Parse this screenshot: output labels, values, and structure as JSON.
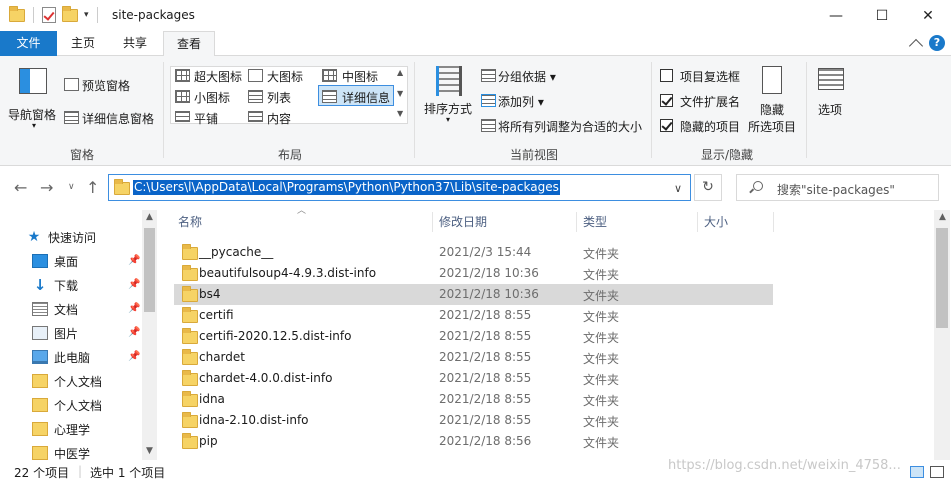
{
  "title": "site-packages",
  "window_controls": {
    "minimize": "—",
    "maximize": "☐",
    "close": "✕"
  },
  "tabs": {
    "file": "文件",
    "home": "主页",
    "share": "共享",
    "view": "查看"
  },
  "ribbon": {
    "pane_group": {
      "nav_pane": "导航窗格",
      "preview_pane": "预览窗格",
      "details_pane": "详细信息窗格",
      "label": "窗格"
    },
    "layout_group": {
      "extra_large_icons": "超大图标",
      "large_icons": "大图标",
      "medium_icons": "中图标",
      "small_icons": "小图标",
      "list": "列表",
      "details": "详细信息",
      "tiles": "平铺",
      "content": "内容",
      "label": "布局"
    },
    "current_view_group": {
      "sort_by": "排序方式",
      "group_by": "分组依据",
      "add_column": "添加列",
      "size_all_columns": "将所有列调整为合适的大小",
      "label": "当前视图"
    },
    "show_hide_group": {
      "item_checkboxes": "项目复选框",
      "item_checkboxes_checked": false,
      "file_extensions": "文件扩展名",
      "file_extensions_checked": true,
      "hidden_items": "隐藏的项目",
      "hidden_items_checked": true,
      "hide_selected_1": "隐藏",
      "hide_selected_2": "所选项目",
      "label": "显示/隐藏"
    },
    "options": "选项"
  },
  "address": {
    "path": "C:\\Users\\l\\AppData\\Local\\Programs\\Python\\Python37\\Lib\\site-packages",
    "search_placeholder": "搜索\"site-packages\""
  },
  "nav": {
    "quick_access": "快速访问",
    "items": [
      {
        "label": "桌面",
        "icon": "desktop-icon",
        "pinned": true
      },
      {
        "label": "下载",
        "icon": "download-icon",
        "pinned": true
      },
      {
        "label": "文档",
        "icon": "document-icon",
        "pinned": true
      },
      {
        "label": "图片",
        "icon": "picture-icon",
        "pinned": true
      },
      {
        "label": "此电脑",
        "icon": "computer-icon",
        "pinned": true
      },
      {
        "label": "个人文档",
        "icon": "folder-icon",
        "pinned": false
      },
      {
        "label": "个人文档",
        "icon": "folder-icon",
        "pinned": false
      },
      {
        "label": "心理学",
        "icon": "folder-icon",
        "pinned": false
      },
      {
        "label": "中医学",
        "icon": "folder-icon",
        "pinned": false
      }
    ]
  },
  "columns": {
    "name": "名称",
    "date": "修改日期",
    "type": "类型",
    "size": "大小"
  },
  "files": [
    {
      "name": "__pycache__",
      "date": "2021/2/3 15:44",
      "type": "文件夹"
    },
    {
      "name": "beautifulsoup4-4.9.3.dist-info",
      "date": "2021/2/18 10:36",
      "type": "文件夹"
    },
    {
      "name": "bs4",
      "date": "2021/2/18 10:36",
      "type": "文件夹"
    },
    {
      "name": "certifi",
      "date": "2021/2/18 8:55",
      "type": "文件夹"
    },
    {
      "name": "certifi-2020.12.5.dist-info",
      "date": "2021/2/18 8:55",
      "type": "文件夹"
    },
    {
      "name": "chardet",
      "date": "2021/2/18 8:55",
      "type": "文件夹"
    },
    {
      "name": "chardet-4.0.0.dist-info",
      "date": "2021/2/18 8:55",
      "type": "文件夹"
    },
    {
      "name": "idna",
      "date": "2021/2/18 8:55",
      "type": "文件夹"
    },
    {
      "name": "idna-2.10.dist-info",
      "date": "2021/2/18 8:55",
      "type": "文件夹"
    },
    {
      "name": "pip",
      "date": "2021/2/18 8:56",
      "type": "文件夹"
    }
  ],
  "selected_index": 2,
  "status": {
    "count": "22 个项目",
    "selected": "选中 1 个项目"
  },
  "watermark": "https://blog.csdn.net/weixin_4758..."
}
